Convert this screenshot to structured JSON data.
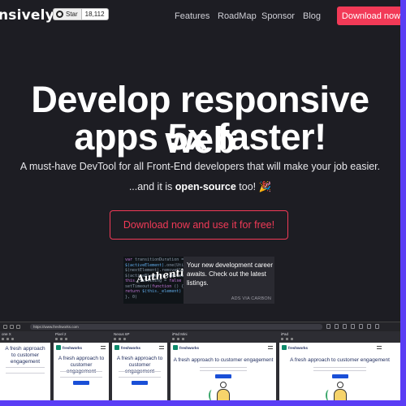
{
  "header": {
    "logo": "nsively",
    "github": {
      "star_label": "Star",
      "star_count": "18,112"
    },
    "nav": [
      "Features",
      "RoadMap",
      "Sponsor",
      "Blog"
    ],
    "download_label": "Download now"
  },
  "hero": {
    "title_line1": "Develop responsive web",
    "title_line2": "apps 5x faster!",
    "subtitle": "A must-have DevTool for all Front-End developers that will make your job easier.",
    "note_prefix": "...and it is ",
    "note_bold": "open-source",
    "note_suffix": " too! 🎉",
    "cta_label": "Download now and use it for free!"
  },
  "ad": {
    "image_caption": "Authentic",
    "text": "Your new development career awaits. Check out the latest listings.",
    "via": "ADS VIA CARBON"
  },
  "app_preview": {
    "url": "https://www.freshworks.com",
    "devices": [
      {
        "name": "one X"
      },
      {
        "name": "Pixel 2"
      },
      {
        "name": "Nexus 6P"
      },
      {
        "name": "iPad Mini"
      },
      {
        "name": "iPad"
      }
    ],
    "site_logo": "freshworks",
    "site_headline_short": "A fresh approach to customer engagement",
    "site_headline_wide": "A fresh approach to customer engagement"
  },
  "colors": {
    "background": "#1d1d23",
    "accent": "#f23a57",
    "outer_border": "#5a3df5"
  }
}
